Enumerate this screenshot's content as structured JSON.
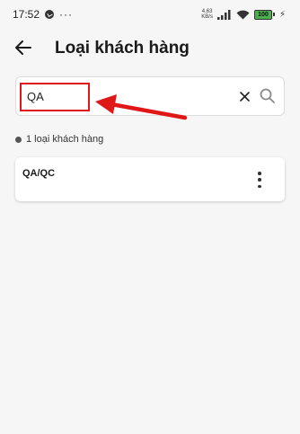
{
  "status_bar": {
    "time": "17:52",
    "more": "···",
    "speed_value": "4.63",
    "speed_unit": "KB/s",
    "battery": "100"
  },
  "header": {
    "title": "Loại khách hàng"
  },
  "search": {
    "value": "QA"
  },
  "results": {
    "count_text": "1 loại khách hàng",
    "items": [
      {
        "label": "QA/QC"
      }
    ]
  },
  "colors": {
    "highlight": "#e01717",
    "background": "#f6f6f6"
  },
  "icons": {
    "back": "arrow-left-icon",
    "clear": "close-icon",
    "search": "search-icon",
    "menu": "more-vertical-icon"
  }
}
